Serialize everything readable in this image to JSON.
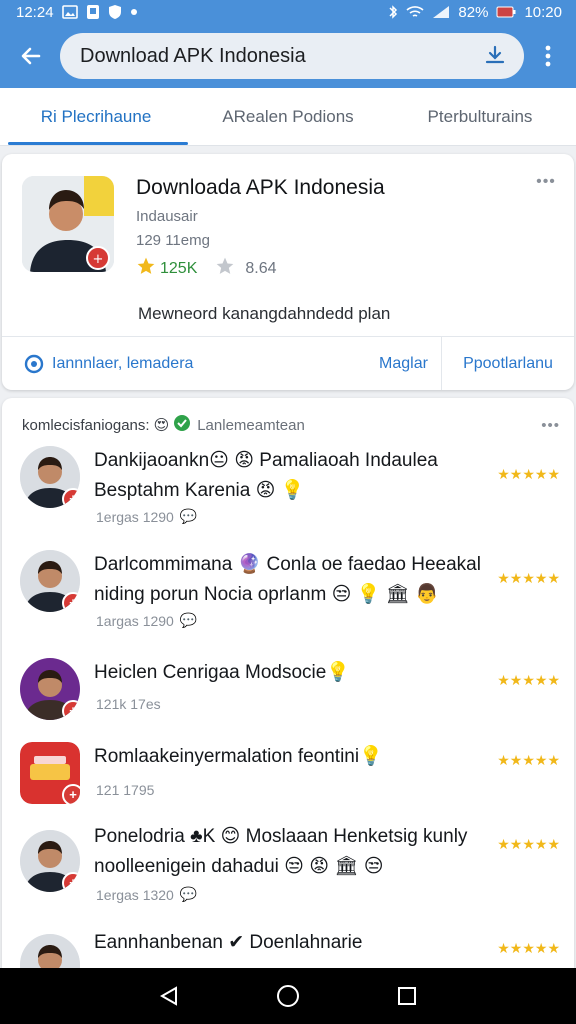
{
  "status_bar": {
    "time": "12:24",
    "battery": "82%",
    "clock_right": "10:20"
  },
  "search": {
    "query": "Download APK Indonesia"
  },
  "tabs": [
    {
      "label": "Ri Plecrihaune"
    },
    {
      "label": "ARealen Podions"
    },
    {
      "label": "Pterbulturains"
    }
  ],
  "app": {
    "title": "Downloada APK Indonesia",
    "developer": "Indausair",
    "size": "129 11emg",
    "rating": "125K",
    "downloads": "8.64",
    "description": "Mewneord kanangdahndedd plan",
    "link_label": "Iannnlaer, lemadera",
    "button1": "Maglar",
    "button2": "Ppootlarlanu",
    "colors": {
      "accent": "#2a77cc",
      "topbar": "#4a90d9",
      "rating": "#2f8f3b"
    }
  },
  "reviews": {
    "header_text": "komlecisfaniogans:",
    "header_sub": "Lanlemeamtean",
    "items": [
      {
        "text": "Dankijaoankn😐 😡 Pamaliaoah Indaulea Besptahm Karenia 😡 💡",
        "meta": "1ergas 1290",
        "stars": "★★★★★"
      },
      {
        "text": "Darlcommimana 🔮 Conla oe faedao Heeakal niding porun Nocia oprlanm 😒 💡 🏛 👨",
        "meta": "1argas 1290",
        "stars": "★★★★★"
      },
      {
        "text": "Heiclen Cenrigaa Modsocie💡",
        "meta": "121k 17es",
        "stars": "★★★★★"
      },
      {
        "text": "Romlaakeinyermalation feontini💡",
        "meta": "121 1795",
        "stars": "★★★★★"
      },
      {
        "text": "Ponelodria ♣K 😊 Moslaaan Henketsig kunly noolleenigein dahadui 😒 😡 🏛 😒",
        "meta": "1ergas 1320",
        "stars": "★★★★★"
      },
      {
        "text": "Eannhanbenan ✔ Doenlahnarie",
        "meta": "",
        "stars": "★★★★★"
      }
    ]
  }
}
